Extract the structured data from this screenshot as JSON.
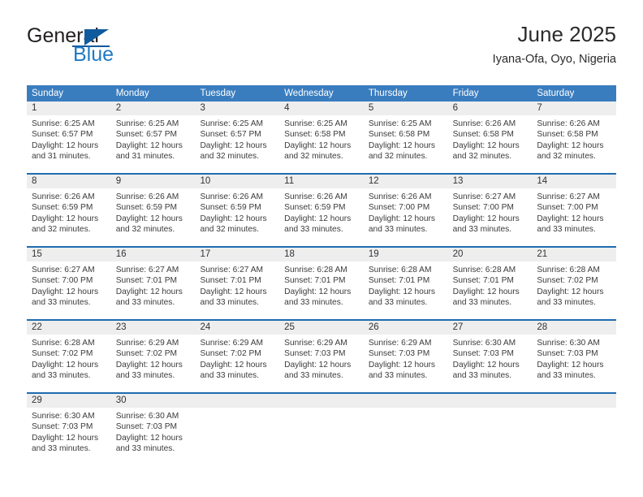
{
  "brand": {
    "word_general": "General",
    "word_blue": "Blue",
    "logo_icon": "triangle-flag-icon",
    "accent_color": "#1f7ac4"
  },
  "header": {
    "title": "June 2025",
    "subtitle": "Iyana-Ofa, Oyo, Nigeria"
  },
  "colors": {
    "header_row_bg": "#3a7dbf",
    "week_divider": "#1f6cb0",
    "daynum_band_bg": "#eeeeee",
    "text": "#3b3b3b"
  },
  "calendar": {
    "weekday_headers": [
      "Sunday",
      "Monday",
      "Tuesday",
      "Wednesday",
      "Thursday",
      "Friday",
      "Saturday"
    ],
    "weeks": [
      [
        {
          "day": "1",
          "lines": [
            "Sunrise: 6:25 AM",
            "Sunset: 6:57 PM",
            "Daylight: 12 hours",
            "and 31 minutes."
          ]
        },
        {
          "day": "2",
          "lines": [
            "Sunrise: 6:25 AM",
            "Sunset: 6:57 PM",
            "Daylight: 12 hours",
            "and 31 minutes."
          ]
        },
        {
          "day": "3",
          "lines": [
            "Sunrise: 6:25 AM",
            "Sunset: 6:57 PM",
            "Daylight: 12 hours",
            "and 32 minutes."
          ]
        },
        {
          "day": "4",
          "lines": [
            "Sunrise: 6:25 AM",
            "Sunset: 6:58 PM",
            "Daylight: 12 hours",
            "and 32 minutes."
          ]
        },
        {
          "day": "5",
          "lines": [
            "Sunrise: 6:25 AM",
            "Sunset: 6:58 PM",
            "Daylight: 12 hours",
            "and 32 minutes."
          ]
        },
        {
          "day": "6",
          "lines": [
            "Sunrise: 6:26 AM",
            "Sunset: 6:58 PM",
            "Daylight: 12 hours",
            "and 32 minutes."
          ]
        },
        {
          "day": "7",
          "lines": [
            "Sunrise: 6:26 AM",
            "Sunset: 6:58 PM",
            "Daylight: 12 hours",
            "and 32 minutes."
          ]
        }
      ],
      [
        {
          "day": "8",
          "lines": [
            "Sunrise: 6:26 AM",
            "Sunset: 6:59 PM",
            "Daylight: 12 hours",
            "and 32 minutes."
          ]
        },
        {
          "day": "9",
          "lines": [
            "Sunrise: 6:26 AM",
            "Sunset: 6:59 PM",
            "Daylight: 12 hours",
            "and 32 minutes."
          ]
        },
        {
          "day": "10",
          "lines": [
            "Sunrise: 6:26 AM",
            "Sunset: 6:59 PM",
            "Daylight: 12 hours",
            "and 32 minutes."
          ]
        },
        {
          "day": "11",
          "lines": [
            "Sunrise: 6:26 AM",
            "Sunset: 6:59 PM",
            "Daylight: 12 hours",
            "and 33 minutes."
          ]
        },
        {
          "day": "12",
          "lines": [
            "Sunrise: 6:26 AM",
            "Sunset: 7:00 PM",
            "Daylight: 12 hours",
            "and 33 minutes."
          ]
        },
        {
          "day": "13",
          "lines": [
            "Sunrise: 6:27 AM",
            "Sunset: 7:00 PM",
            "Daylight: 12 hours",
            "and 33 minutes."
          ]
        },
        {
          "day": "14",
          "lines": [
            "Sunrise: 6:27 AM",
            "Sunset: 7:00 PM",
            "Daylight: 12 hours",
            "and 33 minutes."
          ]
        }
      ],
      [
        {
          "day": "15",
          "lines": [
            "Sunrise: 6:27 AM",
            "Sunset: 7:00 PM",
            "Daylight: 12 hours",
            "and 33 minutes."
          ]
        },
        {
          "day": "16",
          "lines": [
            "Sunrise: 6:27 AM",
            "Sunset: 7:01 PM",
            "Daylight: 12 hours",
            "and 33 minutes."
          ]
        },
        {
          "day": "17",
          "lines": [
            "Sunrise: 6:27 AM",
            "Sunset: 7:01 PM",
            "Daylight: 12 hours",
            "and 33 minutes."
          ]
        },
        {
          "day": "18",
          "lines": [
            "Sunrise: 6:28 AM",
            "Sunset: 7:01 PM",
            "Daylight: 12 hours",
            "and 33 minutes."
          ]
        },
        {
          "day": "19",
          "lines": [
            "Sunrise: 6:28 AM",
            "Sunset: 7:01 PM",
            "Daylight: 12 hours",
            "and 33 minutes."
          ]
        },
        {
          "day": "20",
          "lines": [
            "Sunrise: 6:28 AM",
            "Sunset: 7:01 PM",
            "Daylight: 12 hours",
            "and 33 minutes."
          ]
        },
        {
          "day": "21",
          "lines": [
            "Sunrise: 6:28 AM",
            "Sunset: 7:02 PM",
            "Daylight: 12 hours",
            "and 33 minutes."
          ]
        }
      ],
      [
        {
          "day": "22",
          "lines": [
            "Sunrise: 6:28 AM",
            "Sunset: 7:02 PM",
            "Daylight: 12 hours",
            "and 33 minutes."
          ]
        },
        {
          "day": "23",
          "lines": [
            "Sunrise: 6:29 AM",
            "Sunset: 7:02 PM",
            "Daylight: 12 hours",
            "and 33 minutes."
          ]
        },
        {
          "day": "24",
          "lines": [
            "Sunrise: 6:29 AM",
            "Sunset: 7:02 PM",
            "Daylight: 12 hours",
            "and 33 minutes."
          ]
        },
        {
          "day": "25",
          "lines": [
            "Sunrise: 6:29 AM",
            "Sunset: 7:03 PM",
            "Daylight: 12 hours",
            "and 33 minutes."
          ]
        },
        {
          "day": "26",
          "lines": [
            "Sunrise: 6:29 AM",
            "Sunset: 7:03 PM",
            "Daylight: 12 hours",
            "and 33 minutes."
          ]
        },
        {
          "day": "27",
          "lines": [
            "Sunrise: 6:30 AM",
            "Sunset: 7:03 PM",
            "Daylight: 12 hours",
            "and 33 minutes."
          ]
        },
        {
          "day": "28",
          "lines": [
            "Sunrise: 6:30 AM",
            "Sunset: 7:03 PM",
            "Daylight: 12 hours",
            "and 33 minutes."
          ]
        }
      ],
      [
        {
          "day": "29",
          "lines": [
            "Sunrise: 6:30 AM",
            "Sunset: 7:03 PM",
            "Daylight: 12 hours",
            "and 33 minutes."
          ]
        },
        {
          "day": "30",
          "lines": [
            "Sunrise: 6:30 AM",
            "Sunset: 7:03 PM",
            "Daylight: 12 hours",
            "and 33 minutes."
          ]
        },
        {
          "day": "",
          "lines": []
        },
        {
          "day": "",
          "lines": []
        },
        {
          "day": "",
          "lines": []
        },
        {
          "day": "",
          "lines": []
        },
        {
          "day": "",
          "lines": []
        }
      ]
    ]
  }
}
